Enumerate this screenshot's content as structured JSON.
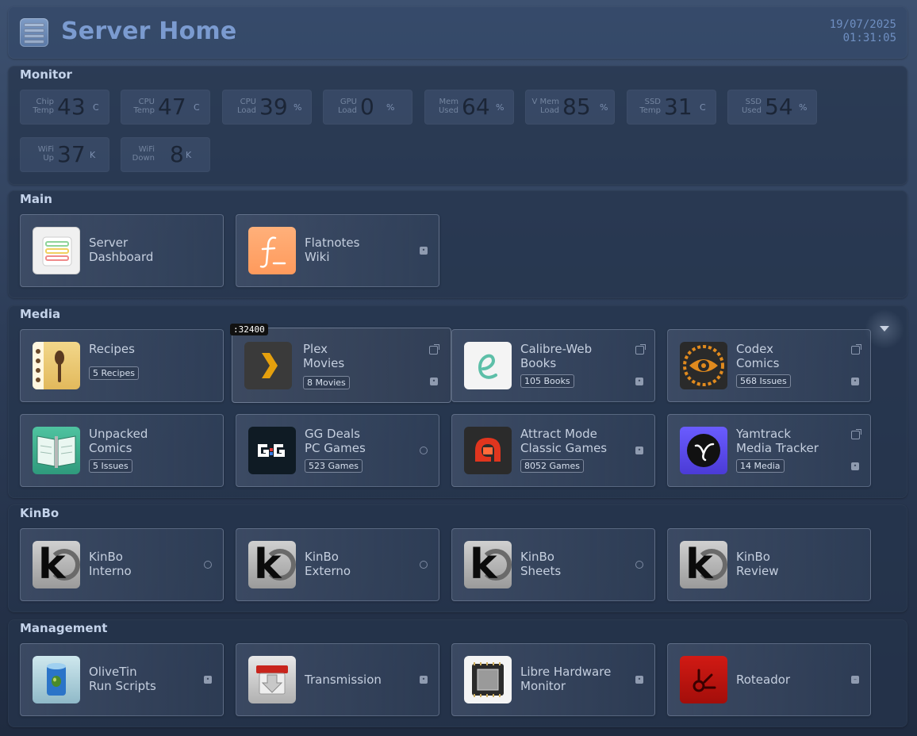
{
  "header": {
    "title": "Server Home",
    "date": "19/07/2025",
    "time": "01:31:05"
  },
  "monitor": {
    "title": "Monitor",
    "widgets": [
      {
        "label1": "Chip",
        "label2": "Temp",
        "value": "43",
        "unit": "C"
      },
      {
        "label1": "CPU",
        "label2": "Temp",
        "value": "47",
        "unit": "C"
      },
      {
        "label1": "CPU",
        "label2": "Load",
        "value": "39",
        "unit": "%"
      },
      {
        "label1": "GPU",
        "label2": "Load",
        "value": "0",
        "unit": "%"
      },
      {
        "label1": "Mem",
        "label2": "Used",
        "value": "64",
        "unit": "%"
      },
      {
        "label1": "V Mem",
        "label2": "Load",
        "value": "85",
        "unit": "%"
      },
      {
        "label1": "SSD",
        "label2": "Temp",
        "value": "31",
        "unit": "C"
      },
      {
        "label1": "SSD",
        "label2": "Used",
        "value": "54",
        "unit": "%"
      },
      {
        "label1": "WiFi",
        "label2": "Up",
        "value": "37",
        "unit": "K"
      },
      {
        "label1": "WiFi",
        "label2": "Down",
        "value": "8",
        "unit": "K"
      }
    ]
  },
  "main": {
    "title": "Main",
    "items": [
      {
        "line1": "Server",
        "line2": "Dashboard"
      },
      {
        "line1": "Flatnotes",
        "line2": "Wiki"
      }
    ]
  },
  "media": {
    "title": "Media",
    "tooltip": ":32400",
    "items": [
      {
        "line1": "Recipes",
        "badge": "5 Recipes"
      },
      {
        "line1": "Plex",
        "line2": "Movies",
        "badge": "8 Movies"
      },
      {
        "line1": "Calibre-Web",
        "line2": "Books",
        "badge": "105 Books"
      },
      {
        "line1": "Codex",
        "line2": "Comics",
        "badge": "568 Issues"
      },
      {
        "line1": "Unpacked",
        "line2": "Comics",
        "badge": "5 Issues"
      },
      {
        "line1": "GG Deals",
        "line2": "PC Games",
        "badge": "523 Games"
      },
      {
        "line1": "Attract Mode",
        "line2": "Classic Games",
        "badge": "8052 Games"
      },
      {
        "line1": "Yamtrack",
        "line2": "Media Tracker",
        "badge": "14 Media"
      }
    ]
  },
  "kinbo": {
    "title": "KinBo",
    "items": [
      {
        "line1": "KinBo",
        "line2": "Interno"
      },
      {
        "line1": "KinBo",
        "line2": "Externo"
      },
      {
        "line1": "KinBo",
        "line2": "Sheets"
      },
      {
        "line1": "KinBo",
        "line2": "Review"
      }
    ]
  },
  "management": {
    "title": "Management",
    "items": [
      {
        "line1": "OliveTin",
        "line2": "Run Scripts"
      },
      {
        "line1": "Transmission"
      },
      {
        "line1": "Libre Hardware",
        "line2": "Monitor"
      },
      {
        "line1": "Roteador"
      }
    ]
  },
  "icons": {
    "header_logo": "server-rack-icon",
    "status_icon": "server-status-icon",
    "external_link": "external-link-icon",
    "globe": "globe-icon",
    "collapse": "chevron-down-icon"
  }
}
